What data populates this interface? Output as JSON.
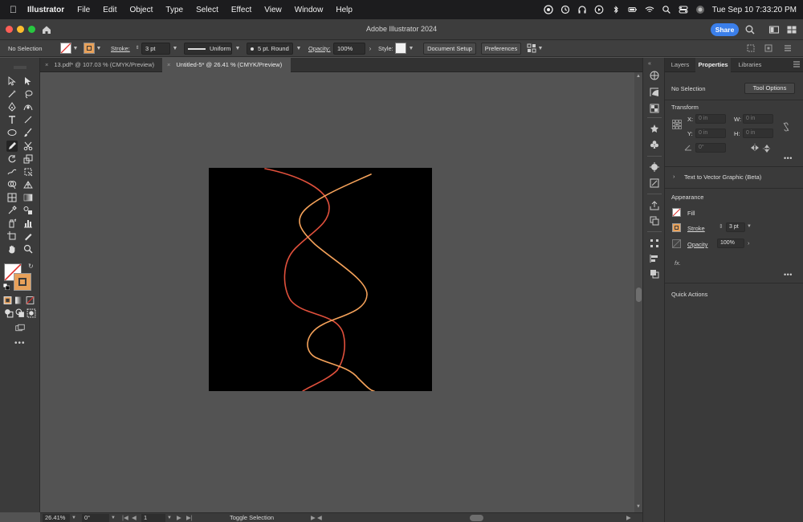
{
  "menubar": {
    "app_name": "Illustrator",
    "items": [
      "File",
      "Edit",
      "Object",
      "Type",
      "Select",
      "Effect",
      "View",
      "Window",
      "Help"
    ],
    "clock": "Tue Sep 10  7:33:20 PM"
  },
  "window": {
    "title": "Adobe Illustrator 2024",
    "share_label": "Share"
  },
  "controlbar": {
    "selection_label": "No Selection",
    "stroke_label": "Stroke:",
    "stroke_weight": "3 pt",
    "profile_label": "Uniform",
    "brush_label": "5 pt. Round",
    "opacity_label": "Opacity:",
    "opacity_value": "100%",
    "style_label": "Style:",
    "doc_setup_label": "Document Setup",
    "preferences_label": "Preferences"
  },
  "tabs": [
    {
      "label": "13.pdf* @ 107.03 % (CMYK/Preview)"
    },
    {
      "label": "Untitled-5* @ 26.41 % (CMYK/Preview)"
    }
  ],
  "toolbar": {
    "colors": {
      "fill": "none",
      "stroke": "#e8a15a"
    }
  },
  "artboard": {
    "background": "#000000",
    "paths": [
      {
        "name": "red-wave",
        "color": "#e0503c"
      },
      {
        "name": "orange-wave",
        "color": "#f5a25a"
      }
    ]
  },
  "statusbar": {
    "zoom": "26.41%",
    "rotation": "0°",
    "artboard_number": "1",
    "tool_name": "Toggle Selection"
  },
  "panel": {
    "tabs": [
      "Layers",
      "Properties",
      "Libraries"
    ],
    "active_tab": "Properties",
    "selection_label": "No Selection",
    "tool_options_label": "Tool Options",
    "transform": {
      "title": "Transform",
      "x_label": "X:",
      "y_label": "Y:",
      "w_label": "W:",
      "h_label": "H:",
      "x_value": "0 in",
      "y_value": "0 in",
      "w_value": "0 in",
      "h_value": "0 in",
      "angle_value": "0°"
    },
    "text_to_vector": "Text to Vector Graphic (Beta)",
    "appearance": {
      "title": "Appearance",
      "fill_label": "Fill",
      "stroke_label": "Stroke",
      "stroke_weight": "3 pt",
      "opacity_label": "Opacity",
      "opacity_value": "100%",
      "fx_label": "fx."
    },
    "quick_actions": "Quick Actions"
  }
}
